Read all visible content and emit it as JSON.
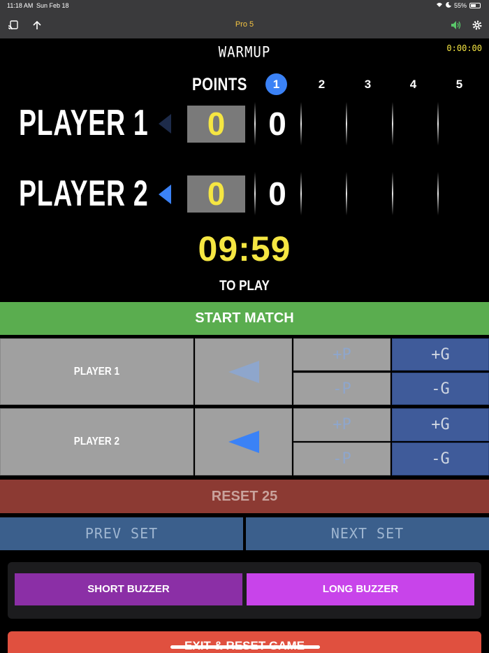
{
  "status_bar": {
    "time": "11:18 AM",
    "date": "Sun Feb 18",
    "battery": "55%",
    "battery_level": 0.55
  },
  "toolbar": {
    "title": "Pro 5",
    "icons": [
      "cast-icon",
      "up-arrow-icon",
      "speaker-icon",
      "gear-icon"
    ]
  },
  "scoreboard": {
    "mode": "WARMUP",
    "elapsed": "0:00:00",
    "points_label": "POINTS",
    "sets": [
      "1",
      "2",
      "3",
      "4",
      "5"
    ],
    "active_set": "1",
    "players": [
      {
        "name": "PLAYER 1",
        "points": "0",
        "games": "0",
        "serving": false
      },
      {
        "name": "PLAYER 2",
        "points": "0",
        "games": "0",
        "serving": true
      }
    ],
    "countdown": "09:59",
    "countdown_label": "TO PLAY"
  },
  "controls": {
    "start_match": "START MATCH",
    "rows": [
      {
        "player_label": "PLAYER 1",
        "plus_p": "+P",
        "minus_p": "-P",
        "plus_g": "+G",
        "minus_g": "-G"
      },
      {
        "player_label": "PLAYER 2",
        "plus_p": "+P",
        "minus_p": "-P",
        "plus_g": "+G",
        "minus_g": "-G"
      }
    ],
    "reset": "RESET 25",
    "prev_set": "PREV SET",
    "next_set": "NEXT SET",
    "short_buzzer": "SHORT BUZZER",
    "long_buzzer": "LONG BUZZER",
    "exit": "EXIT & RESET GAME"
  },
  "colors": {
    "accent_blue": "#3b82f6",
    "score_yellow": "#f5e642",
    "start_green": "#5aad4f",
    "reset_red": "#8c3a33",
    "exit_red": "#e0503f",
    "short_buzzer": "#8b2fa6",
    "long_buzzer": "#c844ea"
  }
}
